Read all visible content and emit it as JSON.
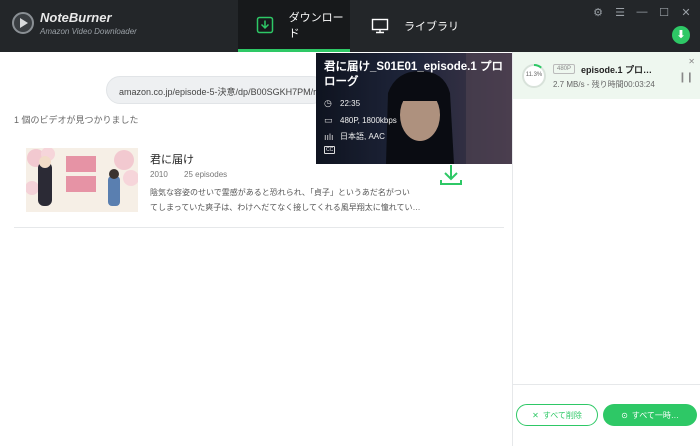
{
  "app": {
    "name": "NoteBurner",
    "subtitle": "Amazon Video Downloader"
  },
  "nav": {
    "download_label": "ダウンロード",
    "library_label": "ライブラリ"
  },
  "search": {
    "url": "amazon.co.jp/episode-5-決意/dp/B00SGKH7PM/re"
  },
  "results": {
    "found_text": "1 個のビデオが見つかりました",
    "items": [
      {
        "title": "君に届け",
        "year": "2010",
        "episodes": "25 episodes",
        "description_line1": "陰気な容姿のせいで霊感があると恐れられ、「貞子」というあだ名がつい",
        "description_line2": "てしまっていた爽子は、わけへだてなく接してくれる風早翔太に憧れてい…"
      }
    ]
  },
  "popup": {
    "title": "君に届け_S01E01_episode.1 プロローグ",
    "duration": "22:35",
    "quality": "480P, 1800kbps",
    "audio": "日本語, AAC",
    "subtitle_icon": "CC"
  },
  "tasks": [
    {
      "progress": "11.3%",
      "progress_value": 0.113,
      "badge": "480P",
      "title": "episode.1 プロ…",
      "speed": "2.7 MB/s - 残り時間00:03:24"
    }
  ],
  "buttons": {
    "clear_all": "すべて削除",
    "pause_all": "すべて一時…"
  },
  "colors": {
    "accent": "#2ec866",
    "titlebar": "#232629"
  }
}
